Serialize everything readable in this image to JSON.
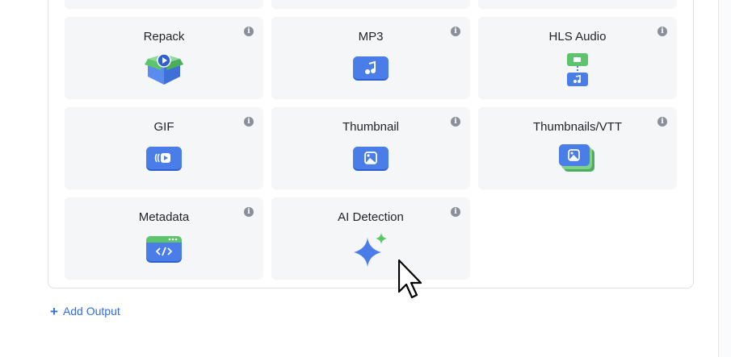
{
  "outputs": {
    "cards": [
      {
        "title": "Repack",
        "icon": "repack-box-icon"
      },
      {
        "title": "MP3",
        "icon": "music-note-icon"
      },
      {
        "title": "HLS Audio",
        "icon": "hls-audio-icon"
      },
      {
        "title": "GIF",
        "icon": "gif-play-icon"
      },
      {
        "title": "Thumbnail",
        "icon": "image-icon"
      },
      {
        "title": "Thumbnails/VTT",
        "icon": "image-stack-icon"
      },
      {
        "title": "Metadata",
        "icon": "code-window-icon"
      },
      {
        "title": "AI Detection",
        "icon": "sparkle-icon"
      }
    ],
    "info_glyph": "i"
  },
  "actions": {
    "add_output_label": "Add Output",
    "add_icon": "+"
  },
  "colors": {
    "accent": "#2f6fe0",
    "icon_blue": "#4a7de8",
    "icon_green": "#5cc46b",
    "card_bg": "#f5f6f8"
  }
}
